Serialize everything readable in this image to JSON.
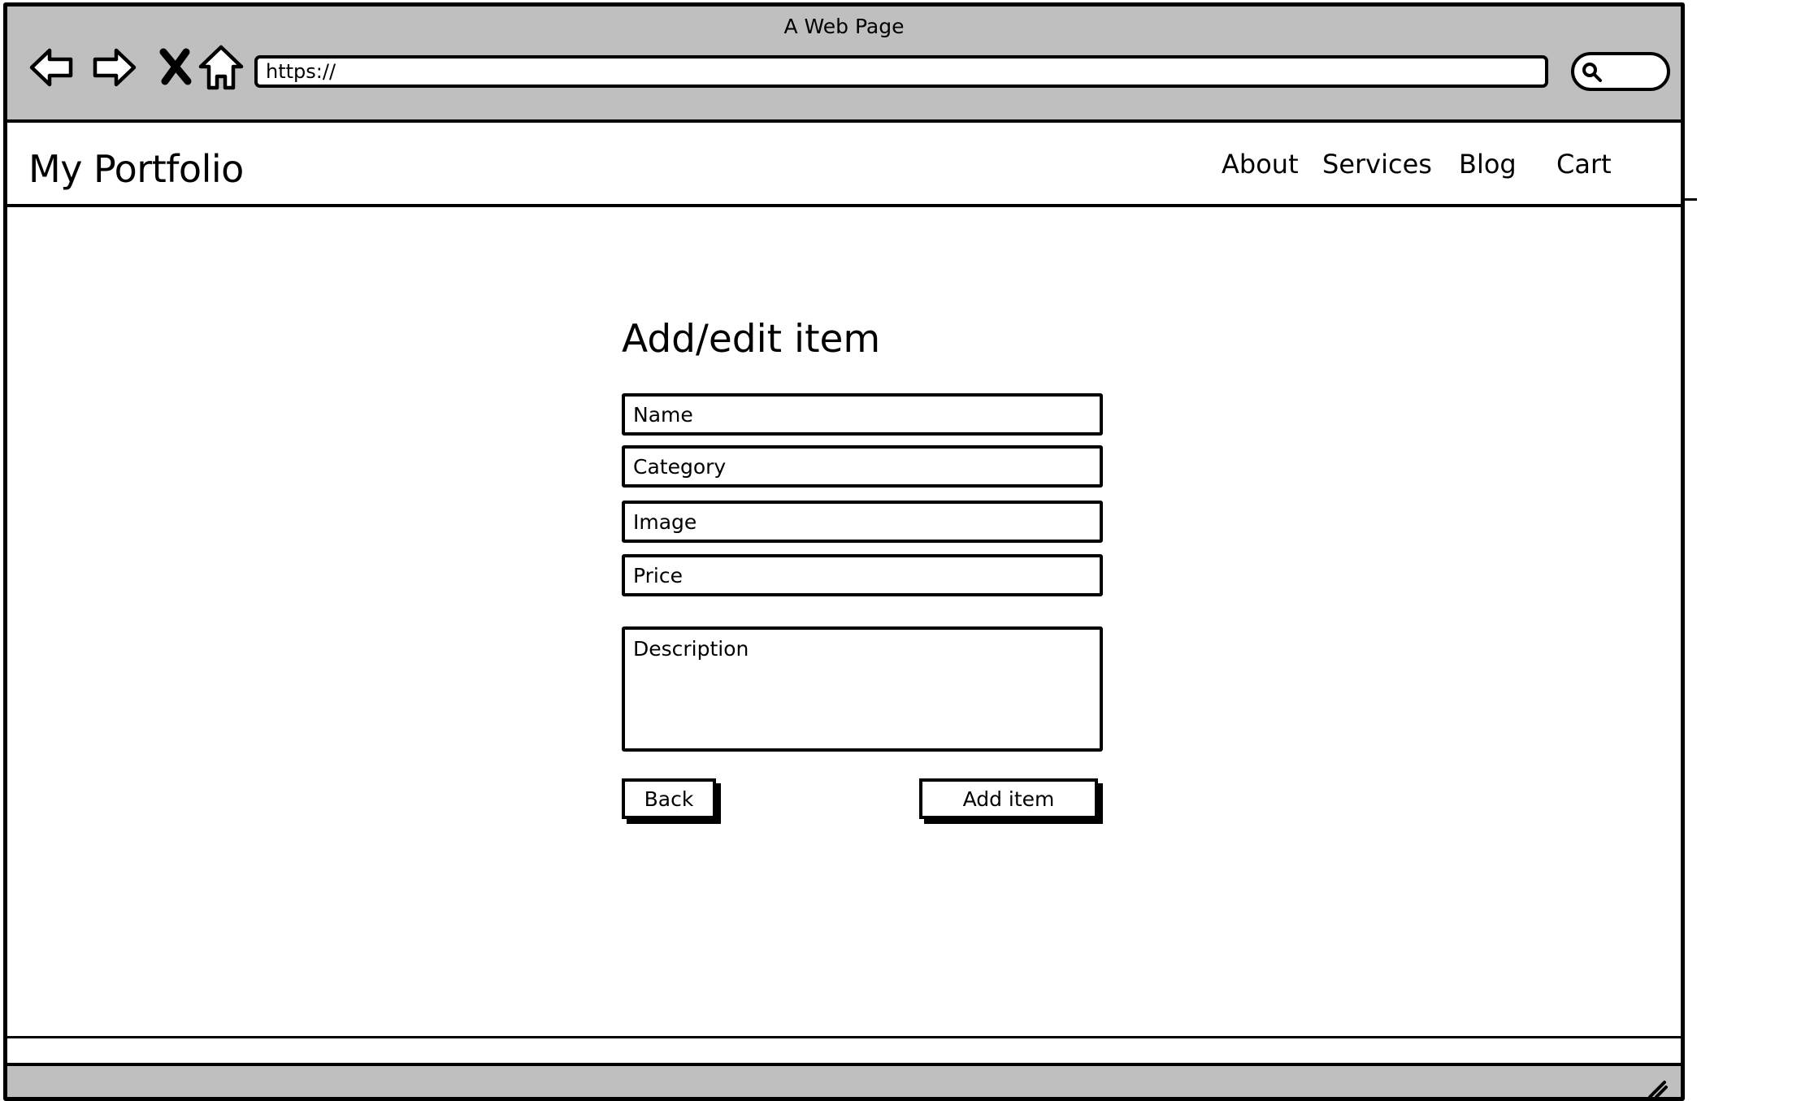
{
  "window": {
    "title": "A Web Page"
  },
  "toolbar": {
    "back_icon": "arrow-left-icon",
    "forward_icon": "arrow-right-icon",
    "stop_icon": "close-icon",
    "home_icon": "home-icon",
    "url": "https://",
    "search_icon": "search-icon"
  },
  "header": {
    "brand": "My Portfolio",
    "nav": [
      {
        "label": "About"
      },
      {
        "label": "Services"
      },
      {
        "label": "Blog"
      },
      {
        "label": "Cart"
      }
    ]
  },
  "form": {
    "title": "Add/edit item",
    "fields": {
      "name": {
        "placeholder": "Name",
        "value": ""
      },
      "category": {
        "placeholder": "Category",
        "value": ""
      },
      "image": {
        "placeholder": "Image",
        "value": ""
      },
      "price": {
        "placeholder": "Price",
        "value": ""
      },
      "description": {
        "placeholder": "Description",
        "value": ""
      }
    },
    "back_label": "Back",
    "submit_label": "Add item"
  },
  "colors": {
    "chrome": "#bfbfbf",
    "border": "#000000",
    "background": "#ffffff"
  }
}
